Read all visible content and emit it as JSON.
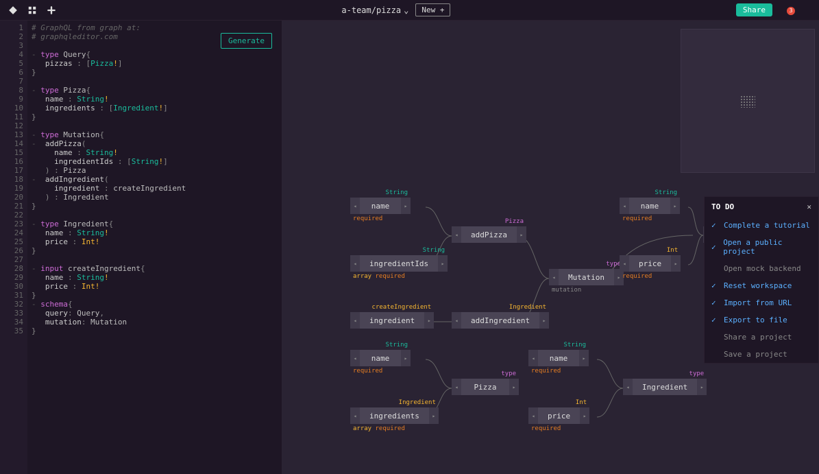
{
  "header": {
    "project": "a-team/pizza",
    "new_label": "New +",
    "share_label": "Share",
    "notification_count": "3"
  },
  "generate_label": "Generate",
  "code": {
    "lines": [
      "1",
      "2",
      "3",
      "4",
      "5",
      "6",
      "7",
      "8",
      "9",
      "10",
      "11",
      "12",
      "13",
      "14",
      "15",
      "16",
      "17",
      "18",
      "19",
      "20",
      "21",
      "22",
      "23",
      "24",
      "25",
      "26",
      "27",
      "28",
      "29",
      "30",
      "31",
      "32",
      "33",
      "34",
      "35"
    ],
    "l1": "# GraphQL from graph at:",
    "l2": "# graphqleditor.com",
    "kw_type": "type",
    "kw_input": "input",
    "kw_schema": "schema",
    "t_query": "Query",
    "t_pizza": "Pizza",
    "t_mutation": "Mutation",
    "t_ingredient": "Ingredient",
    "t_create": "createIngredient",
    "f_pizzas": "pizzas",
    "f_name": "name",
    "f_ingredients": "ingredients",
    "f_addPizza": "addPizza",
    "f_ingredientIds": "ingredientIds",
    "f_addIngredient": "addIngredient",
    "f_ingredient": "ingredient",
    "f_price": "price",
    "f_query": "query",
    "f_mutation": "mutation",
    "ty_Pizza": "Pizza",
    "ty_String": "String",
    "ty_Ingredient": "Ingredient",
    "ty_Int": "Int",
    "ty_createIngredient": "createIngredient",
    "ty_Query": "Query",
    "ty_Mutation": "Mutation"
  },
  "nodes": {
    "name1": "name",
    "ingredientIds": "ingredientIds",
    "ingredient": "ingredient",
    "addPizza": "addPizza",
    "addIngredient": "addIngredient",
    "mutation": "Mutation",
    "name2": "name",
    "price1": "price",
    "name3": "name",
    "ingredients": "ingredients",
    "pizza": "Pizza",
    "name4": "name",
    "price2": "price",
    "ingredientType": "Ingredient"
  },
  "tags": {
    "String": "String",
    "Int": "Int",
    "type": "type",
    "required": "required",
    "array": "array",
    "createIngredient": "createIngredient",
    "Ingredient": "Ingredient",
    "Pizza": "Pizza",
    "mutation": "mutation"
  },
  "todo": {
    "title": "TO DO",
    "items": [
      {
        "done": true,
        "label": "Complete a tutorial"
      },
      {
        "done": true,
        "label": "Open a public project"
      },
      {
        "done": false,
        "label": "Open mock backend"
      },
      {
        "done": true,
        "label": "Reset workspace"
      },
      {
        "done": true,
        "label": "Import from URL"
      },
      {
        "done": true,
        "label": "Export to file"
      },
      {
        "done": false,
        "label": "Share a project"
      },
      {
        "done": false,
        "label": "Save a project"
      }
    ]
  }
}
